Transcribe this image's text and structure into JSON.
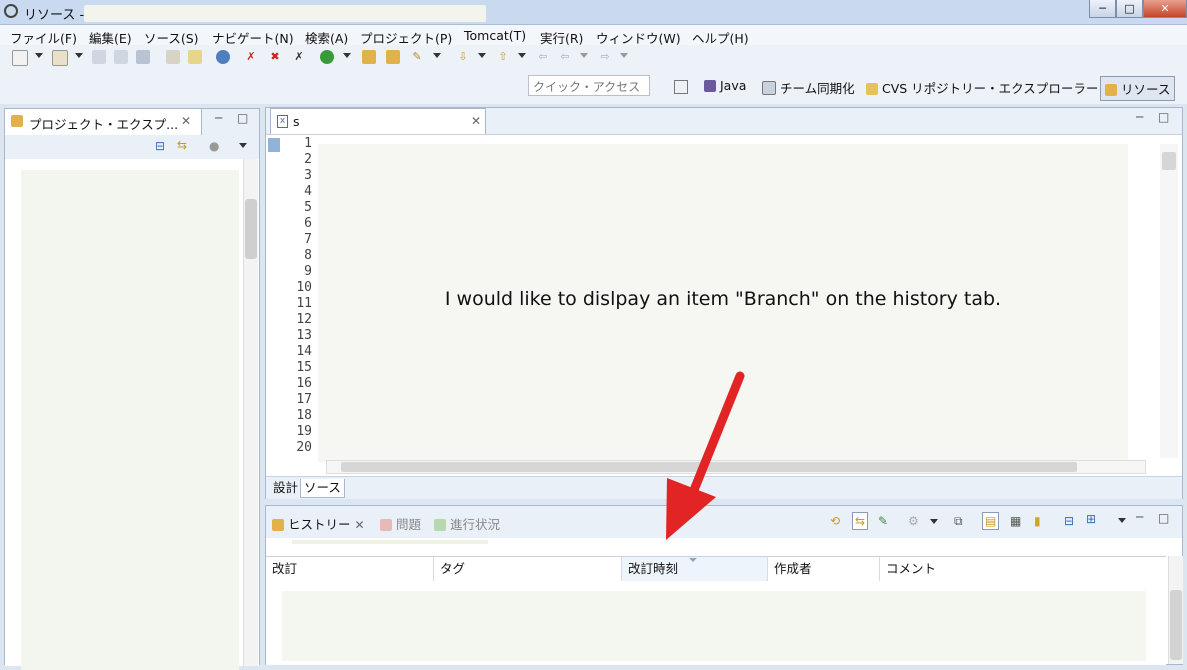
{
  "window": {
    "title": "リソース -",
    "minimize": "─",
    "maximize": "□",
    "close": "✕"
  },
  "menu": [
    "ファイル(F)",
    "編集(E)",
    "ソース(S)",
    "ナビゲート(N)",
    "検索(A)",
    "プロジェクト(P)",
    "Tomcat(T)",
    "実行(R)",
    "ウィンドウ(W)",
    "ヘルプ(H)"
  ],
  "toolbar": {
    "quick_access_placeholder": "クイック・アクセス"
  },
  "perspectives": [
    "Java",
    "チーム同期化",
    "CVS リポジトリー・エクスプローラー",
    "リソース"
  ],
  "left_panel": {
    "tab_label": "プロジェクト・エクスプ..."
  },
  "editor": {
    "tab_label": "s",
    "line_numbers": [
      "1",
      "2",
      "3",
      "4",
      "5",
      "6",
      "7",
      "8",
      "9",
      "10",
      "11",
      "12",
      "13",
      "14",
      "15",
      "16",
      "17",
      "18",
      "19",
      "20"
    ],
    "bottom_tabs": [
      "設計",
      "ソース"
    ]
  },
  "annotation": {
    "text": "I would like to dislpay an item \"Branch\" on the history tab."
  },
  "history_panel": {
    "tabs": [
      "ヒストリー",
      "問題",
      "進行状況"
    ],
    "columns": [
      "改訂",
      "タグ",
      "改訂時刻",
      "作成者",
      "コメント"
    ]
  },
  "colors": {
    "accent_arrow": "#e32424",
    "chrome": "#dbe6f1"
  }
}
